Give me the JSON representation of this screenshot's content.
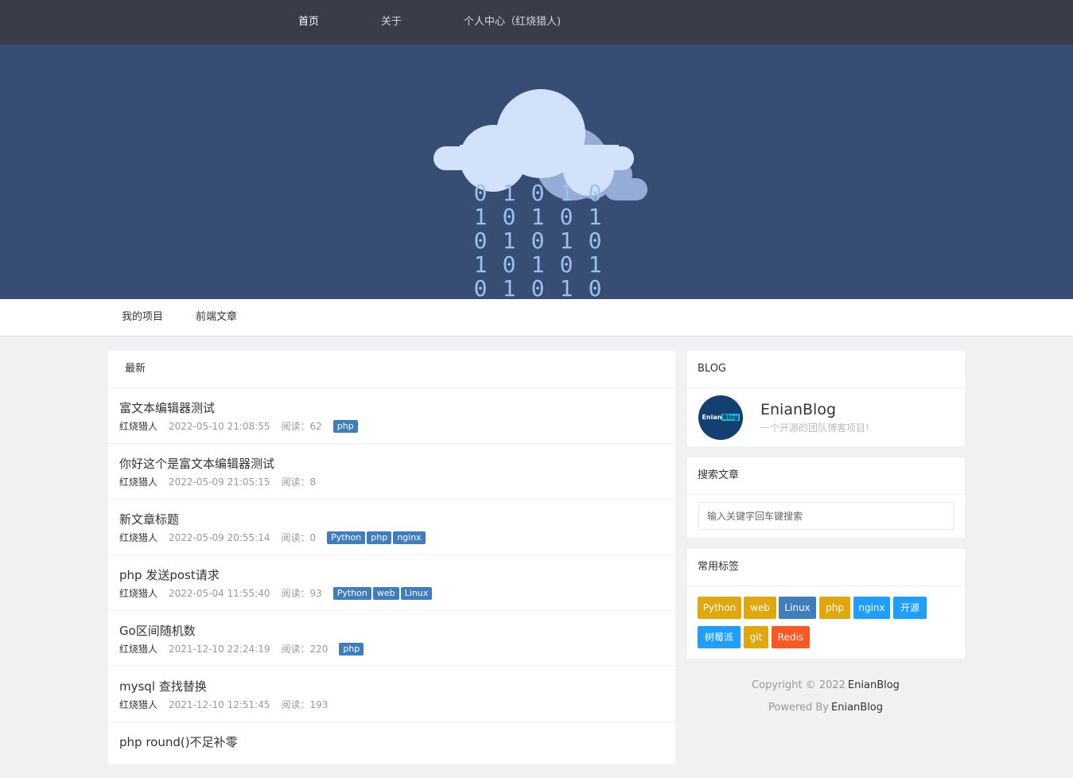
{
  "topnav": {
    "items": [
      {
        "label": "首页"
      },
      {
        "label": "关于"
      },
      {
        "label": "个人中心（红烧猎人)"
      }
    ]
  },
  "banner": {
    "binary_rows": [
      [
        "0",
        "1",
        "0",
        "1",
        "0"
      ],
      [
        "1",
        "0",
        "1",
        "0",
        "1"
      ],
      [
        "0",
        "1",
        "0",
        "1",
        "0"
      ],
      [
        "1",
        "0",
        "1",
        "0",
        "1"
      ],
      [
        "0",
        "1",
        "0",
        "1",
        "0"
      ]
    ],
    "colors": {
      "background": "#374d73",
      "cloud_front": "#d3e2fb",
      "cloud_back": "#94acd6",
      "digits": "#9cc0ec"
    }
  },
  "subnav": {
    "items": [
      {
        "label": "我的项目"
      },
      {
        "label": "前端文章"
      }
    ]
  },
  "latest": {
    "heading": "最新",
    "articles": [
      {
        "title": "富文本编辑器测试",
        "author": "红烧猎人",
        "date": "2022-05-10 21:08:55",
        "reads": "阅读：62",
        "tags": [
          "php"
        ]
      },
      {
        "title": "你好这个是富文本编辑器测试",
        "author": "红烧猎人",
        "date": "2022-05-09 21:05:15",
        "reads": "阅读：8",
        "tags": []
      },
      {
        "title": "新文章标题",
        "author": "红烧猎人",
        "date": "2022-05-09 20:55:14",
        "reads": "阅读：0",
        "tags": [
          "Python",
          "php",
          "nginx"
        ]
      },
      {
        "title": "php 发送post请求",
        "author": "红烧猎人",
        "date": "2022-05-04 11:55:40",
        "reads": "阅读：93",
        "tags": [
          "Python",
          "web",
          "Linux"
        ]
      },
      {
        "title": "Go区间随机数",
        "author": "红烧猎人",
        "date": "2021-12-10 22:24:19",
        "reads": "阅读：220",
        "tags": [
          "php"
        ]
      },
      {
        "title": "mysql 查找替换",
        "author": "红烧猎人",
        "date": "2021-12-10 12:51:45",
        "reads": "阅读：193",
        "tags": []
      },
      {
        "title": "php round()不足补零",
        "author": "",
        "date": "",
        "reads": "",
        "tags": []
      }
    ]
  },
  "blog": {
    "heading": "BLOG",
    "avatar_text_a": "Enian",
    "avatar_text_b": "Blog",
    "name": "EnianBlog",
    "description": "一个开源的团队博客项目!"
  },
  "search": {
    "heading": "搜索文章",
    "placeholder": "输入关键字回车键搜索"
  },
  "common_tags": {
    "heading": "常用标签",
    "tags": [
      {
        "label": "Python",
        "color": "#e0a80e"
      },
      {
        "label": "web",
        "color": "#e0a80e"
      },
      {
        "label": "Linux",
        "color": "#3f7dbd"
      },
      {
        "label": "php",
        "color": "#e0a80e"
      },
      {
        "label": "nginx",
        "color": "#1e9fff"
      },
      {
        "label": "开源",
        "color": "#1e9fff"
      },
      {
        "label": "树莓派",
        "color": "#1e9fff"
      },
      {
        "label": "git",
        "color": "#e0a80e"
      },
      {
        "label": "Redis",
        "color": "#ff5722"
      }
    ]
  },
  "footer": {
    "copyright_prefix": "Copyright © 2022",
    "copyright_name": "EnianBlog",
    "powered_prefix": "Powered By",
    "powered_name": "EnianBlog"
  }
}
